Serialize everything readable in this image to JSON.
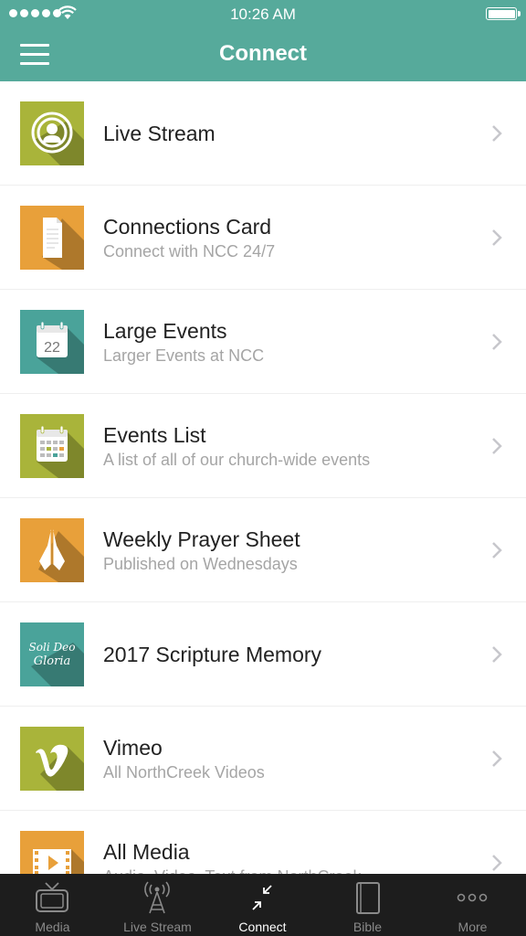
{
  "status_bar": {
    "time": "10:26 AM"
  },
  "nav": {
    "title": "Connect"
  },
  "colors": {
    "accent": "#56aa9b",
    "olive": "#a9b43a",
    "orange": "#e8a03a",
    "teal": "#4aa39a"
  },
  "items": [
    {
      "title": "Live Stream",
      "subtitle": "",
      "icon": "live-stream-icon",
      "color": "#a9b43a"
    },
    {
      "title": "Connections Card",
      "subtitle": "Connect with NCC 24/7",
      "icon": "document-icon",
      "color": "#e8a03a"
    },
    {
      "title": "Large Events",
      "subtitle": "Larger Events at NCC",
      "icon": "calendar-22-icon",
      "color": "#4aa39a"
    },
    {
      "title": "Events List",
      "subtitle": "A list of all of our church-wide events",
      "icon": "calendar-grid-icon",
      "color": "#a9b43a"
    },
    {
      "title": "Weekly Prayer Sheet",
      "subtitle": "Published on Wednesdays",
      "icon": "praying-hands-icon",
      "color": "#e8a03a"
    },
    {
      "title": "2017 Scripture Memory",
      "subtitle": "",
      "icon": "soli-deo-gloria-icon",
      "color": "#4aa39a",
      "icon_text": [
        "Soli Deo",
        "Gloria"
      ]
    },
    {
      "title": "Vimeo",
      "subtitle": "All NorthCreek Videos",
      "icon": "vimeo-icon",
      "color": "#a9b43a"
    },
    {
      "title": "All Media",
      "subtitle": "Audio, Video, Text from NorthCreek",
      "icon": "film-icon",
      "color": "#e8a03a"
    }
  ],
  "tabs": [
    {
      "label": "Media",
      "icon": "tv-icon",
      "active": false
    },
    {
      "label": "Live Stream",
      "icon": "broadcast-tower-icon",
      "active": false
    },
    {
      "label": "Connect",
      "icon": "connect-arrows-icon",
      "active": true
    },
    {
      "label": "Bible",
      "icon": "book-icon",
      "active": false
    },
    {
      "label": "More",
      "icon": "more-dots-icon",
      "active": false
    }
  ]
}
